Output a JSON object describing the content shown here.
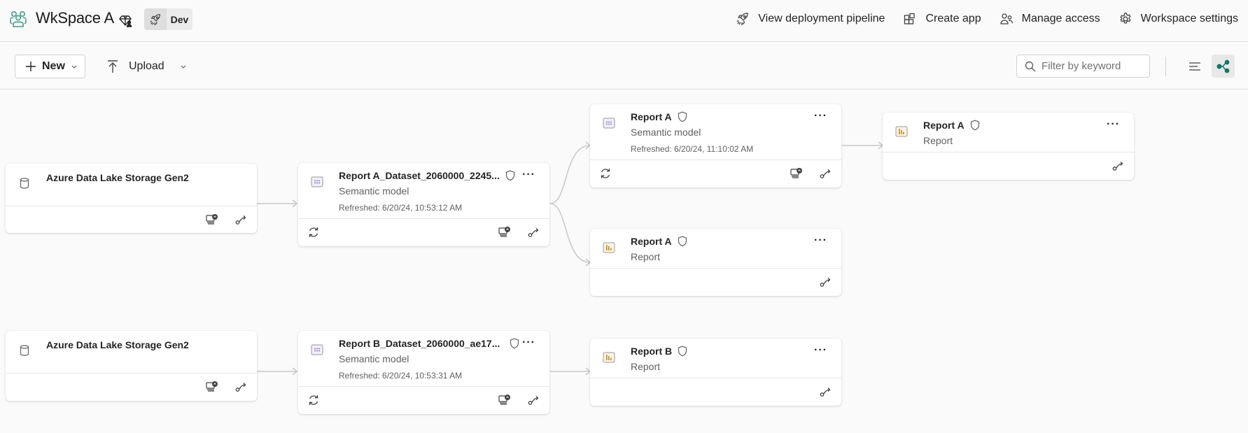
{
  "header": {
    "workspace_title": "WkSpace A",
    "stage_label": "Dev",
    "actions": [
      {
        "label": "View deployment pipeline",
        "icon": "rocket-icon"
      },
      {
        "label": "Create app",
        "icon": "app-icon"
      },
      {
        "label": "Manage access",
        "icon": "people-icon"
      },
      {
        "label": "Workspace settings",
        "icon": "gear-icon"
      }
    ]
  },
  "toolbar": {
    "new_label": "New",
    "upload_label": "Upload",
    "filter_placeholder": "Filter by keyword",
    "view_modes": [
      "list-view",
      "lineage-view"
    ],
    "active_view": "lineage-view"
  },
  "colors": {
    "accent": "#117865",
    "report_icon": "#c48a1a",
    "semantic_icon": "#7b5cc7",
    "edge": "#c8c8c8"
  },
  "lineage": {
    "nodes": [
      {
        "id": "adls1",
        "name": "Azure Data Lake Storage Gen2",
        "kind": "",
        "refreshed": "",
        "type": "datasource"
      },
      {
        "id": "dsA",
        "name": "Report A_Dataset_2060000_2245...",
        "kind": "Semantic model",
        "refreshed": "Refreshed: 6/20/24, 10:53:12 AM",
        "type": "semantic-model"
      },
      {
        "id": "smA",
        "name": "Report A",
        "kind": "Semantic model",
        "refreshed": "Refreshed: 6/20/24, 11:10:02 AM",
        "type": "semantic-model"
      },
      {
        "id": "rptA2",
        "name": "Report A",
        "kind": "Report",
        "refreshed": "",
        "type": "report"
      },
      {
        "id": "rptA1",
        "name": "Report A",
        "kind": "Report",
        "refreshed": "",
        "type": "report"
      },
      {
        "id": "adls2",
        "name": "Azure Data Lake Storage Gen2",
        "kind": "",
        "refreshed": "",
        "type": "datasource"
      },
      {
        "id": "dsB",
        "name": "Report B_Dataset_2060000_ae17...",
        "kind": "Semantic model",
        "refreshed": "Refreshed: 6/20/24, 10:53:31 AM",
        "type": "semantic-model"
      },
      {
        "id": "rptB",
        "name": "Report B",
        "kind": "Report",
        "refreshed": "",
        "type": "report"
      }
    ],
    "edges": [
      [
        "adls1",
        "dsA"
      ],
      [
        "dsA",
        "smA"
      ],
      [
        "dsA",
        "rptA1"
      ],
      [
        "smA",
        "rptA2"
      ],
      [
        "adls2",
        "dsB"
      ],
      [
        "dsB",
        "rptB"
      ]
    ]
  }
}
